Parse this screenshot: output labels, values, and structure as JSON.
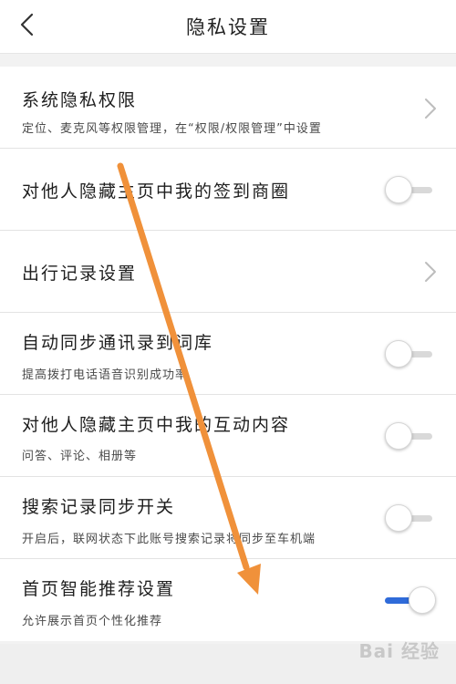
{
  "header": {
    "title": "隐私设置"
  },
  "rows": [
    {
      "id": "system",
      "title": "系统隐私权限",
      "subtitle": "定位、麦克风等权限管理，在“权限/权限管理”中设置",
      "control": "chevron"
    },
    {
      "id": "hide-checkin",
      "title": "对他人隐藏主页中我的签到商圈",
      "subtitle": "",
      "control": "toggle",
      "on": false
    },
    {
      "id": "travel",
      "title": "出行记录设置",
      "subtitle": "",
      "control": "chevron"
    },
    {
      "id": "sync-contacts",
      "title": "自动同步通讯录到词库",
      "subtitle": "提高拨打电话语音识别成功率",
      "control": "toggle",
      "on": false
    },
    {
      "id": "hide-interact",
      "title": "对他人隐藏主页中我的互动内容",
      "subtitle": "问答、评论、相册等",
      "control": "toggle",
      "on": false
    },
    {
      "id": "search-sync",
      "title": "搜索记录同步开关",
      "subtitle": "开启后，联网状态下此账号搜索记录将同步至车机端",
      "control": "toggle",
      "on": false
    },
    {
      "id": "home-recommend",
      "title": "首页智能推荐设置",
      "subtitle": "允许展示首页个性化推荐",
      "control": "toggle",
      "on": true
    }
  ],
  "watermark": "Bai 经验",
  "colors": {
    "accent": "#2f6bd9",
    "annotation": "#f0913a"
  }
}
